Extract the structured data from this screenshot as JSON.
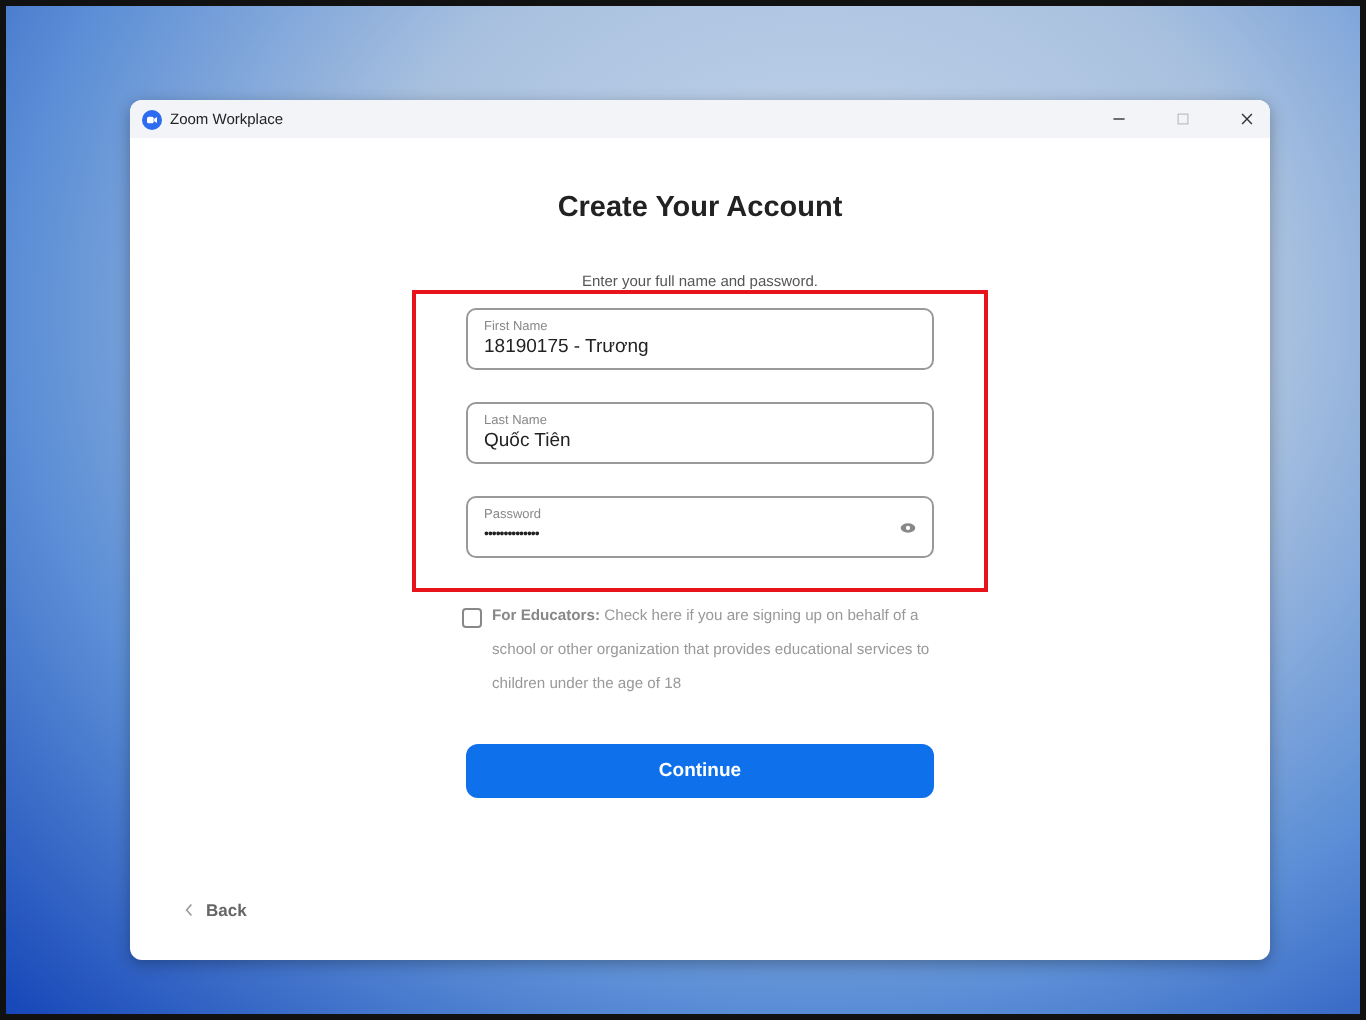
{
  "window": {
    "title": "Zoom Workplace"
  },
  "heading": "Create Your Account",
  "subtitle": "Enter your full name and password.",
  "fields": [
    {
      "kind": "text",
      "placeholder": "First Name",
      "value": "18190175 - Trương"
    },
    {
      "kind": "text",
      "placeholder": "Last Name",
      "value": "Quốc Tiên"
    },
    {
      "kind": "password",
      "placeholder": "Password",
      "value": "••••••••••••••"
    }
  ],
  "educators": {
    "checked": false,
    "text": "**For Educators:** Check here if you are signing up on behalf of a school or other organization that provides educational services to children under the age of 18"
  },
  "continue_button": "Continue",
  "back_link": "Back"
}
